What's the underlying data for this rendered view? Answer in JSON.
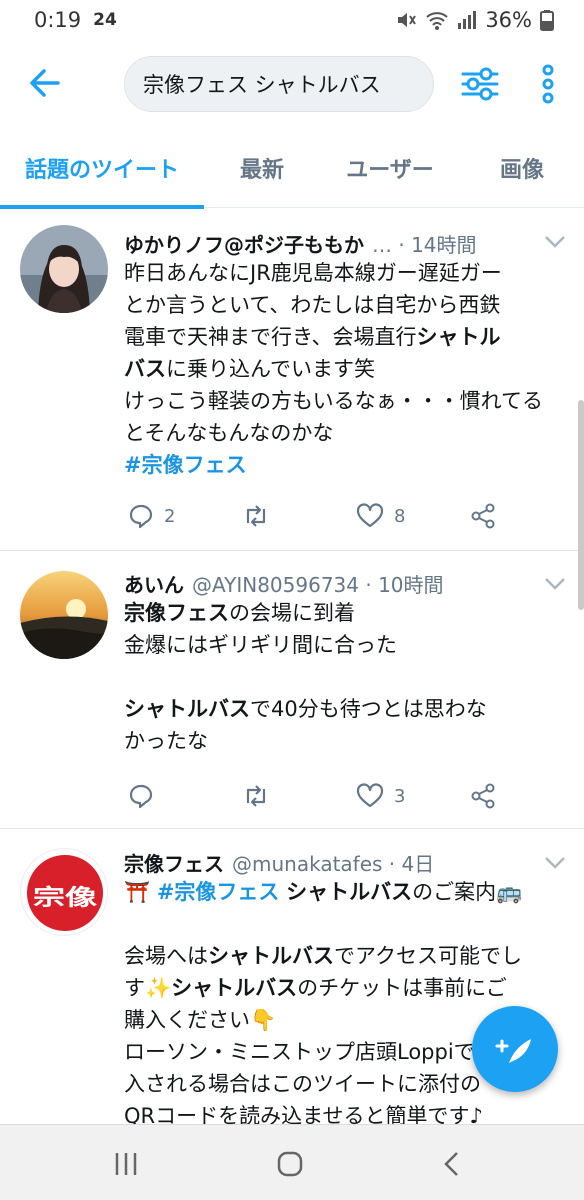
{
  "status_bar": {
    "time": "0:19",
    "badge": "24",
    "battery_text": "36%"
  },
  "search": {
    "query": "宗像フェス シャトルバス"
  },
  "tabs": [
    {
      "label": "話題のツイート",
      "active": true
    },
    {
      "label": "最新",
      "active": false
    },
    {
      "label": "ユーザー",
      "active": false
    },
    {
      "label": "画像",
      "active": false
    }
  ],
  "tweets": [
    {
      "name": "ゆかりノフ@ポジ子ももか",
      "meta": "… · 14時間",
      "lines": [
        [
          {
            "t": "昨日あんなにJR鹿児島本線ガー遅延ガー"
          }
        ],
        [
          {
            "t": "とか言うといて、わたしは自宅から西鉄"
          }
        ],
        [
          {
            "t": "電車で天神まで行き、会場直行"
          },
          {
            "t": "シャトル",
            "b": true
          }
        ],
        [
          {
            "t": "バス",
            "b": true
          },
          {
            "t": "に乗り込んでいます笑"
          }
        ],
        [
          {
            "t": "けっこう軽装の方もいるなぁ・・・慣れてる"
          }
        ],
        [
          {
            "t": "とそんなもんなのかな"
          }
        ],
        [
          {
            "t": "#宗像フェス",
            "h": true
          }
        ]
      ],
      "replies": "2",
      "retweets": "",
      "likes": "8"
    },
    {
      "name": "あいん",
      "meta": "@AYIN80596734 · 10時間",
      "lines": [
        [
          {
            "t": "宗像フェス",
            "b": true
          },
          {
            "t": "の会場に到着"
          }
        ],
        [
          {
            "t": "金爆にはギリギリ間に合った"
          }
        ],
        [
          {
            "t": ""
          }
        ],
        [
          {
            "t": "シャトルバス",
            "b": true
          },
          {
            "t": "で40分も待つとは思わな"
          }
        ],
        [
          {
            "t": "かったな"
          }
        ]
      ],
      "replies": "",
      "retweets": "",
      "likes": "3"
    },
    {
      "name": "宗像フェス",
      "meta": "@munakatafes · 4日",
      "lines": [
        [
          {
            "t": "⛩️ "
          },
          {
            "t": "#宗像フェス",
            "h": true
          },
          {
            "t": " "
          },
          {
            "t": "シャトルバス",
            "b": true
          },
          {
            "t": "のご案内🚌"
          }
        ],
        [
          {
            "t": ""
          }
        ],
        [
          {
            "t": "会場へは"
          },
          {
            "t": "シャトルバス",
            "b": true
          },
          {
            "t": "でアクセス可能でし"
          }
        ],
        [
          {
            "t": "す✨"
          },
          {
            "t": "シャトルバス",
            "b": true
          },
          {
            "t": "のチケットは事前にご"
          }
        ],
        [
          {
            "t": "購入ください👇"
          }
        ],
        [
          {
            "t": "ローソン・ミニストップ店頭Loppiで購"
          }
        ],
        [
          {
            "t": "入される場合はこのツイートに添付の"
          }
        ],
        [
          {
            "t": "QRコードを読み込ませると簡単です♪"
          }
        ]
      ]
    }
  ],
  "avatar_logo_text": "宗像フェス",
  "colors": {
    "accent": "#1da1f2",
    "hashtag": "#1b95e0",
    "meta": "#657786"
  },
  "icons": [
    "back-arrow-icon",
    "filter-sliders-icon",
    "more-vertical-icon",
    "reply-icon",
    "retweet-icon",
    "like-heart-icon",
    "share-icon",
    "compose-tweet-icon",
    "recent-apps-icon",
    "home-icon",
    "nav-back-icon"
  ]
}
